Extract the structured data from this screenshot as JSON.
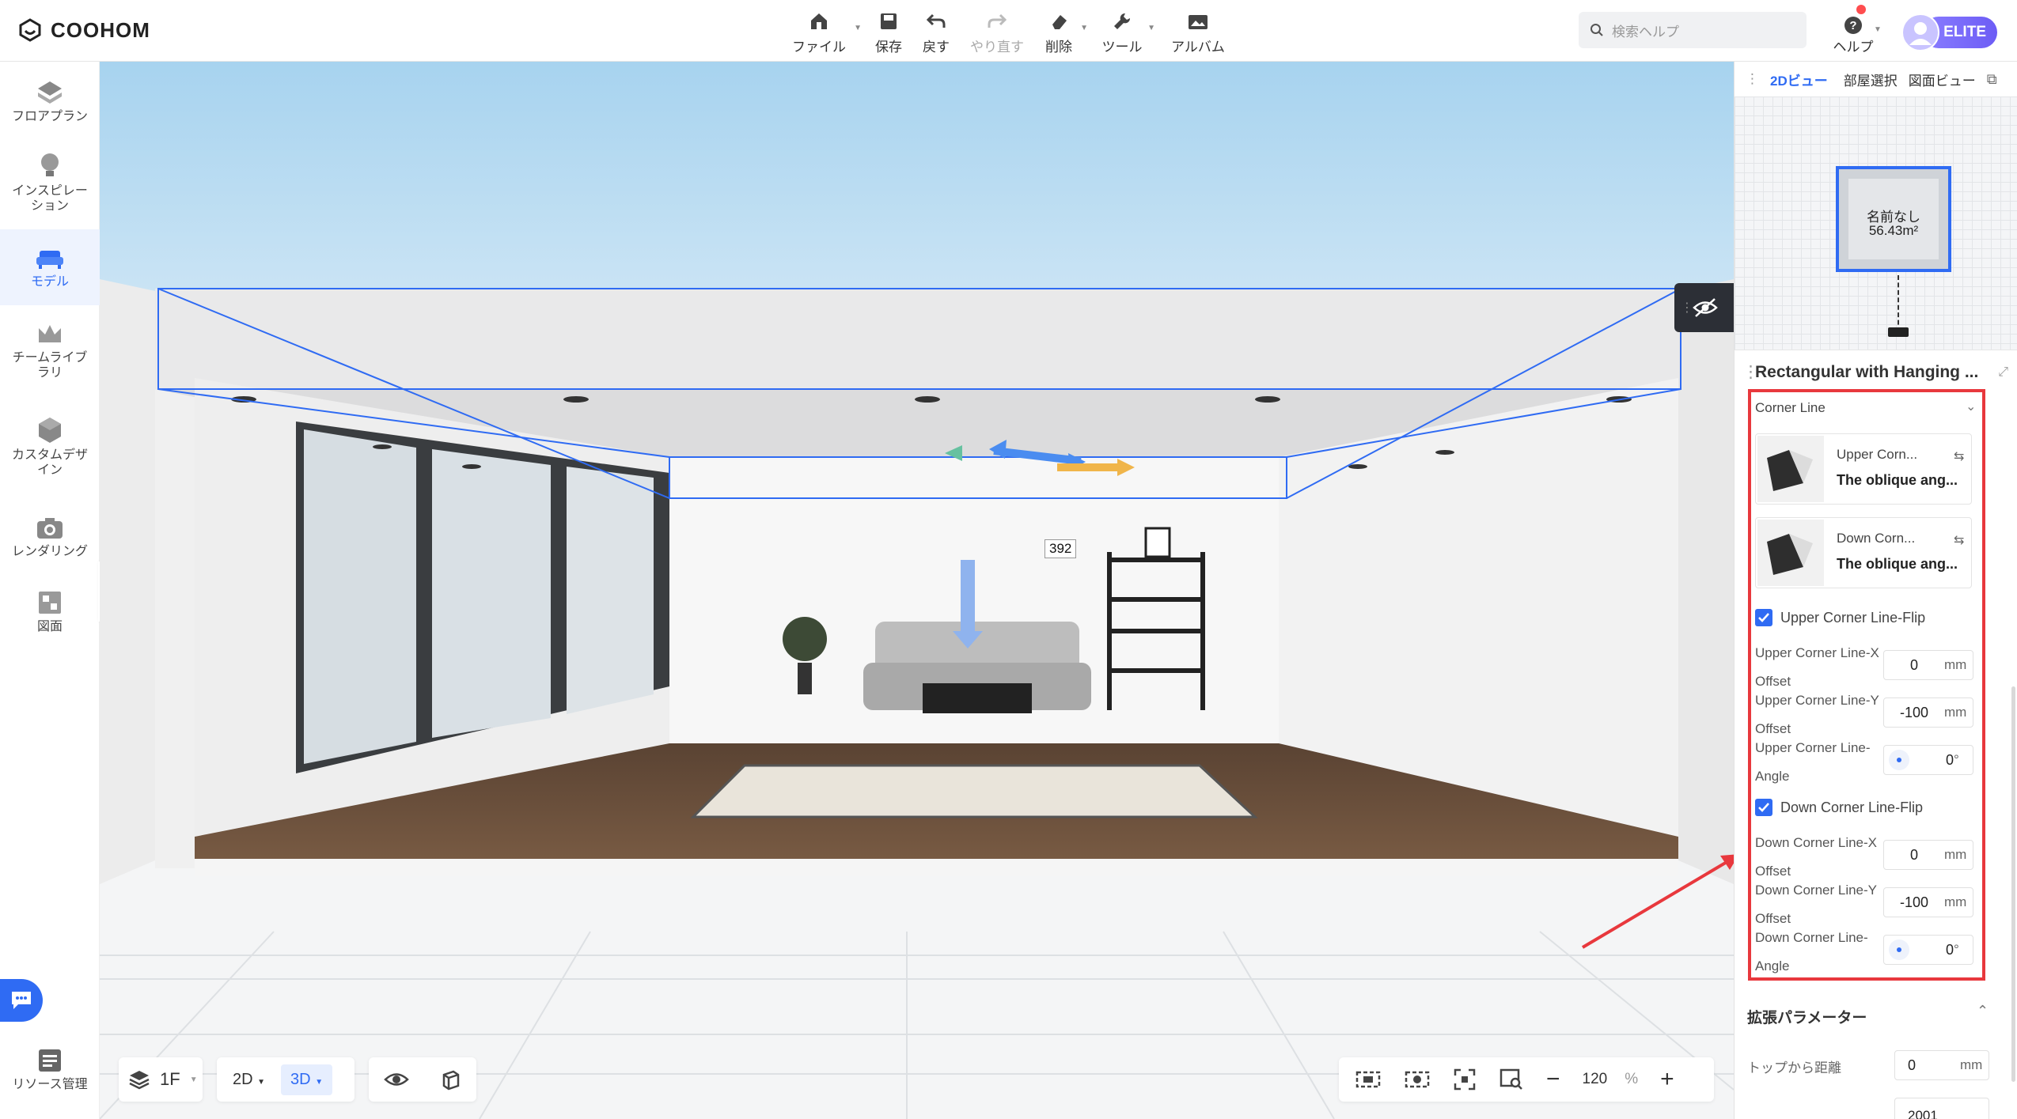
{
  "app": {
    "brand": "COOHOM"
  },
  "toolbar": {
    "file": "ファイル",
    "save": "保存",
    "undo": "戻す",
    "redo": "やり直す",
    "delete": "削除",
    "tools": "ツール",
    "album": "アルバム"
  },
  "search": {
    "placeholder": "検索ヘルプ"
  },
  "help": {
    "label": "ヘルプ"
  },
  "account": {
    "badge": "ELITE"
  },
  "sidebar": {
    "items": [
      {
        "label": "フロアプラン"
      },
      {
        "label": "インスピレー\nション"
      },
      {
        "label": "モデル"
      },
      {
        "label": "チームライブ\nラリ"
      },
      {
        "label": "カスタムデザ\nイン"
      },
      {
        "label": "レンダリング"
      },
      {
        "label": "図面"
      }
    ],
    "resource": "リソース管理"
  },
  "viewport": {
    "dimension_label": "392",
    "bottom": {
      "floor": "1F",
      "view2d": "2D",
      "view3d": "3D",
      "zoom": "120",
      "zoom_unit": "%"
    }
  },
  "right_panel": {
    "tabs": [
      "2Dビュー",
      "部屋選択",
      "図面ビュー"
    ],
    "room": {
      "name": "名前なし",
      "area": "56.43m²"
    },
    "title": "Rectangular with Hanging ...",
    "corner_line": {
      "section_title": "Corner Line",
      "upper": {
        "name": "Upper Corn...",
        "value": "The oblique ang..."
      },
      "down": {
        "name": "Down Corn...",
        "value": "The oblique ang..."
      },
      "upper_flip_label": "Upper Corner Line-Flip",
      "down_flip_label": "Down Corner Line-Flip",
      "fields": [
        {
          "label": "Upper Corner Line-X Offset",
          "value": "0",
          "unit": "mm"
        },
        {
          "label": "Upper Corner Line-Y Offset",
          "value": "-100",
          "unit": "mm"
        },
        {
          "label": "Upper Corner Line-Angle",
          "value": "0",
          "unit": "°"
        },
        {
          "label": "Down Corner Line-X Offset",
          "value": "0",
          "unit": "mm"
        },
        {
          "label": "Down Corner Line-Y Offset",
          "value": "-100",
          "unit": "mm"
        },
        {
          "label": "Down Corner Line-Angle",
          "value": "0",
          "unit": "°"
        }
      ]
    },
    "extended": {
      "title": "拡張パラメーター",
      "top_distance": {
        "label": "トップから距離",
        "value": "0",
        "unit": "mm"
      },
      "next_value": "2001"
    }
  },
  "colors": {
    "accent": "#2f6bf3",
    "highlight": "#e8383d"
  }
}
